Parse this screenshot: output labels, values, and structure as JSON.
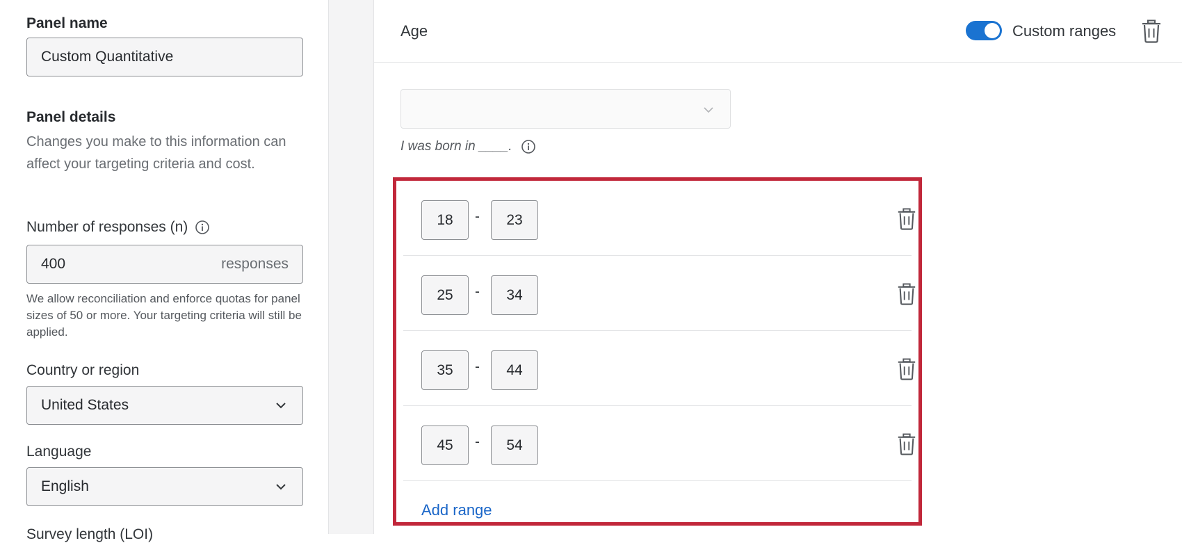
{
  "sidebar": {
    "panel_name_label": "Panel name",
    "panel_name_value": "Custom Quantitative",
    "panel_details_label": "Panel details",
    "panel_details_desc": "Changes you make to this information can affect your targeting criteria and cost.",
    "responses_label": "Number of responses (n)",
    "responses_value": "400",
    "responses_suffix": "responses",
    "responses_note": "We allow reconciliation and enforce quotas for panel sizes of 50 or more. Your targeting criteria will still be applied.",
    "country_label": "Country or region",
    "country_value": "United States",
    "language_label": "Language",
    "language_value": "English",
    "survey_length_label": "Survey length (LOI)"
  },
  "panel": {
    "title": "Age",
    "custom_ranges_label": "Custom ranges",
    "custom_ranges_on": true,
    "question_text": "I was born in ____.",
    "ranges": [
      {
        "min": "18",
        "max": "23"
      },
      {
        "min": "25",
        "max": "34"
      },
      {
        "min": "35",
        "max": "44"
      },
      {
        "min": "45",
        "max": "54"
      }
    ],
    "range_separator": "-",
    "add_range_label": "Add range"
  },
  "colors": {
    "accent_blue": "#1a73d1",
    "link_blue": "#1a66c8",
    "highlight_red": "#c1273a"
  }
}
